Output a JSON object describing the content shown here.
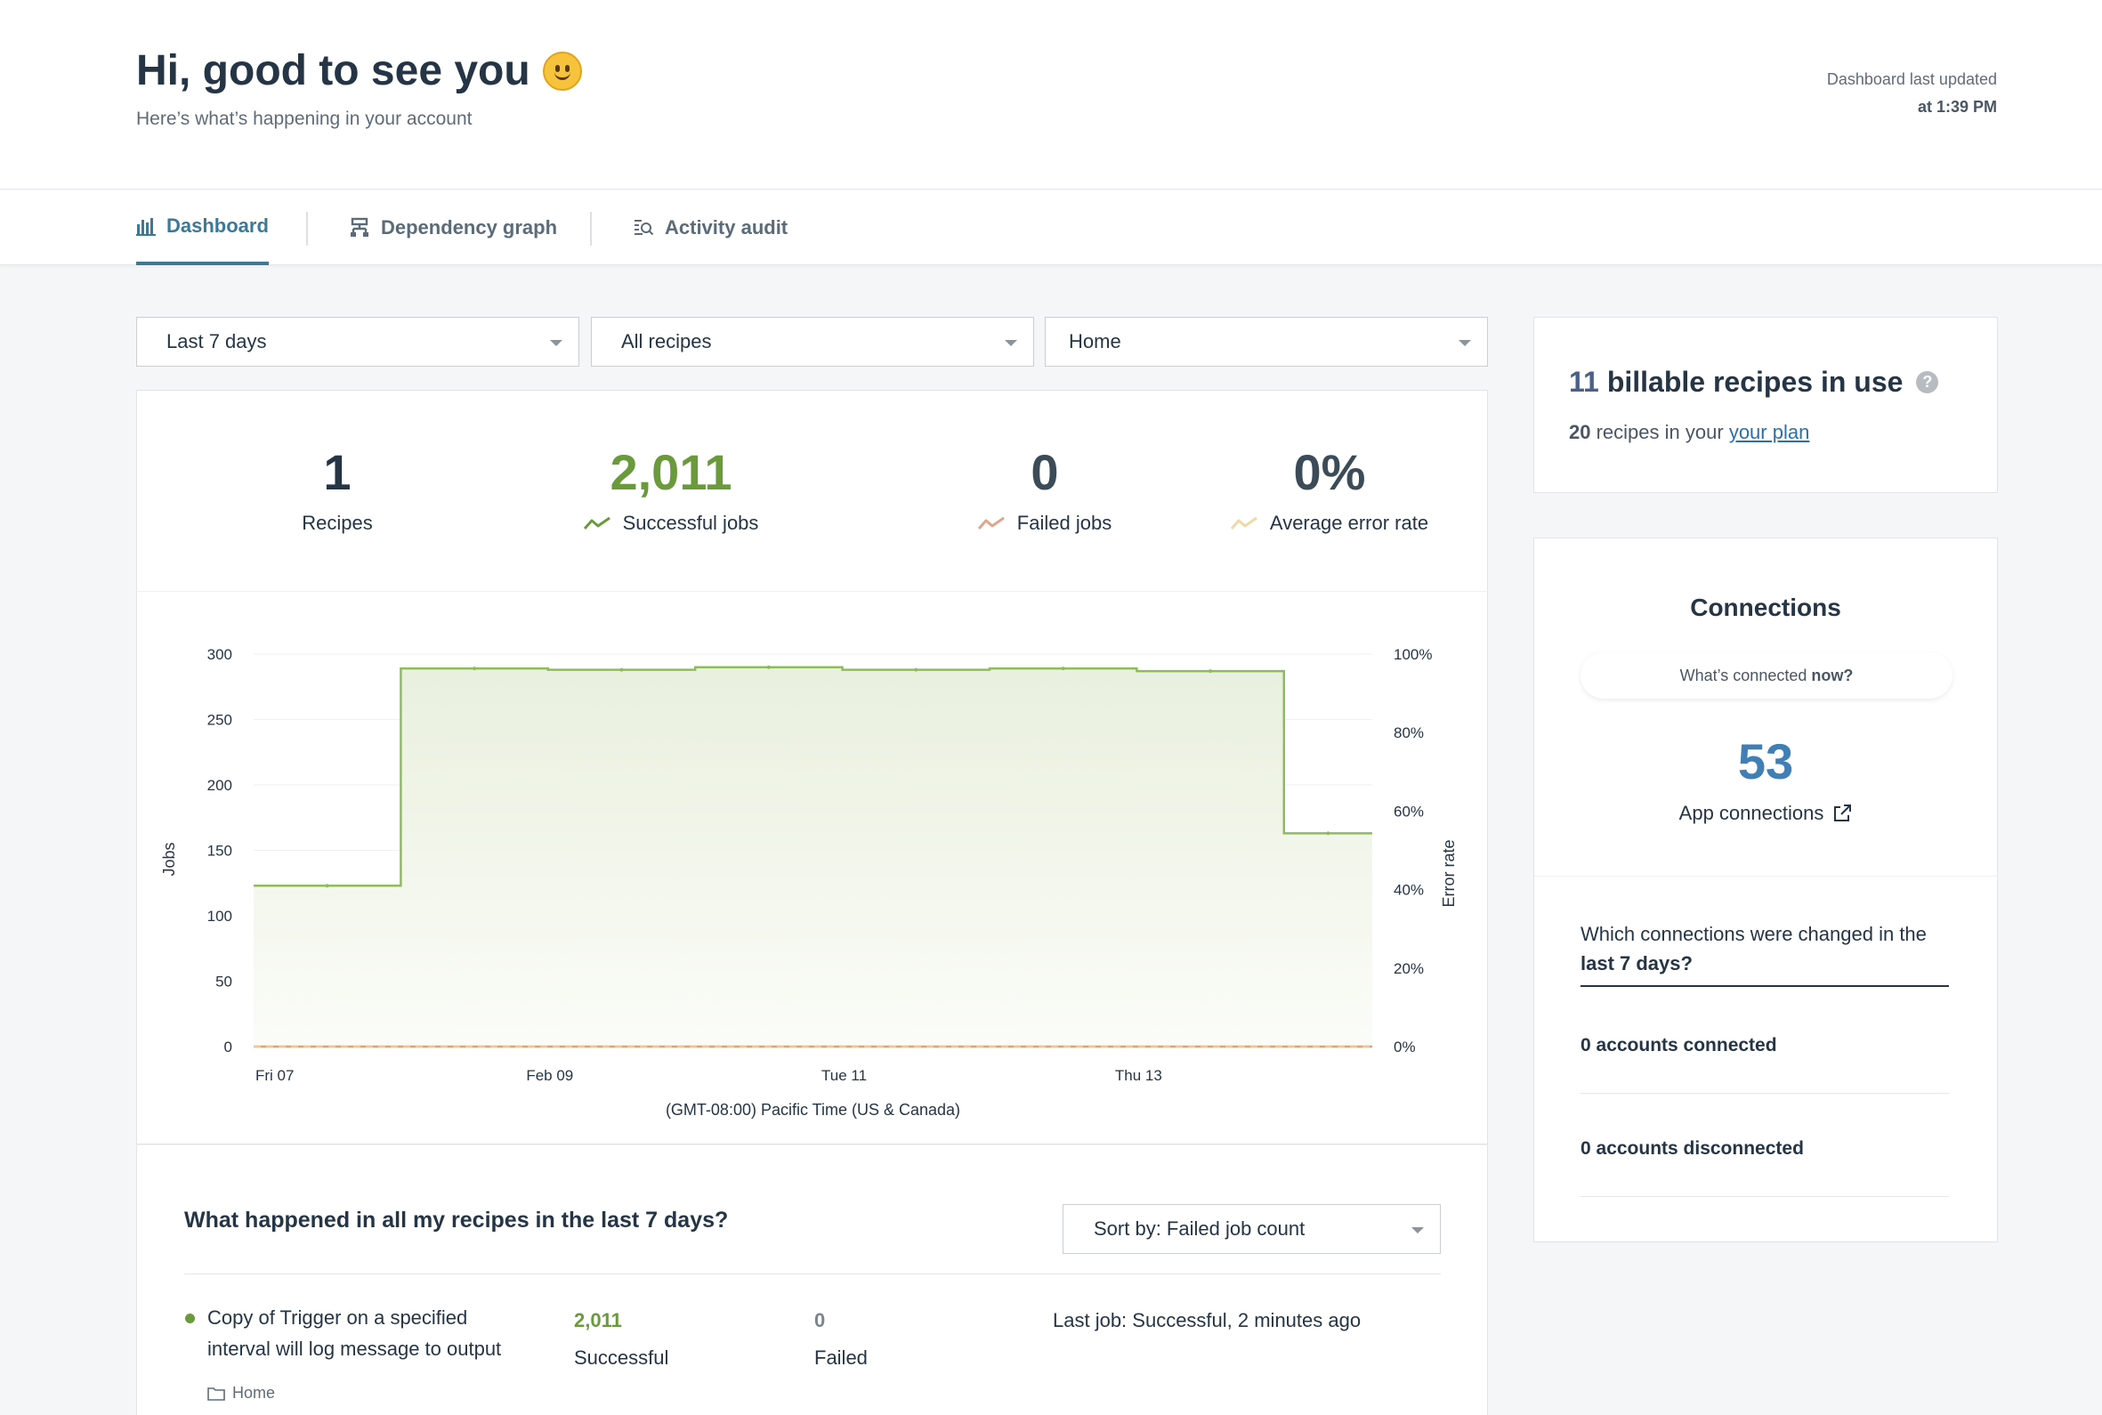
{
  "header": {
    "greeting": "Hi, good to see you",
    "subtitle": "Here’s what’s happening in your account",
    "updated_label": "Dashboard last updated",
    "updated_time": "at 1:39 PM"
  },
  "tabs": [
    {
      "label": "Dashboard",
      "icon": "bar-chart-icon",
      "active": true
    },
    {
      "label": "Dependency graph",
      "icon": "hierarchy-icon",
      "active": false
    },
    {
      "label": "Activity audit",
      "icon": "audit-search-icon",
      "active": false
    }
  ],
  "filters": {
    "period": "Last 7 days",
    "recipes": "All recipes",
    "folder": "Home"
  },
  "stats": [
    {
      "value": "1",
      "label": "Recipes",
      "color": "#253545"
    },
    {
      "value": "2,011",
      "label": "Successful jobs",
      "color": "#6a9a3b"
    },
    {
      "value": "0",
      "label": "Failed jobs",
      "color": "#3c4b58"
    },
    {
      "value": "0%",
      "label": "Average error rate",
      "color": "#3c4b58"
    }
  ],
  "colors": {
    "success": "#6a9a3b",
    "failed": "#e0a590",
    "error_rate": "#f0d9a6",
    "accent": "#3a7a98",
    "link": "#2b6fae"
  },
  "chart_data": {
    "type": "area",
    "xlabel": "(GMT-08:00) Pacific Time (US & Canada)",
    "ylabel": "Jobs",
    "y2label": "Error rate",
    "ylim": [
      0,
      300
    ],
    "y2lim": [
      0,
      100
    ],
    "yticks": [
      "0",
      "50",
      "100",
      "150",
      "200",
      "250",
      "300"
    ],
    "y2ticks": [
      "0%",
      "20%",
      "40%",
      "60%",
      "80%",
      "100%"
    ],
    "xticks": [
      "Fri 07",
      "Feb 09",
      "Tue 11",
      "Thu 13"
    ],
    "grid": true,
    "series": [
      {
        "name": "Successful jobs",
        "step": true,
        "values": [
          123,
          289,
          288,
          290,
          288,
          289,
          287,
          163
        ]
      },
      {
        "name": "Failed jobs",
        "step": true,
        "values": [
          0,
          0,
          0,
          0,
          0,
          0,
          0,
          0
        ]
      }
    ]
  },
  "recipes_section": {
    "title": "What happened in all my recipes in the last 7 days?",
    "sort_label": "Sort by: Failed job count",
    "rows": [
      {
        "name": "Copy of Trigger on a specified interval will log message to output",
        "folder": "Home",
        "successful": "2,011",
        "successful_label": "Successful",
        "failed": "0",
        "failed_label": "Failed",
        "last_job": "Last job: Successful, 2 minutes ago"
      }
    ]
  },
  "billing": {
    "count": "11",
    "title": "billable recipes in use",
    "plan_count": "20",
    "plan_text": "recipes in your",
    "plan_link": "your plan"
  },
  "connections": {
    "title": "Connections",
    "pill_text": "What’s connected",
    "pill_bold": "now?",
    "count": "53",
    "count_label": "App connections",
    "question": "Which connections were changed in the",
    "question_bold": "last 7 days?",
    "connected": "0 accounts connected",
    "disconnected": "0 accounts disconnected"
  }
}
